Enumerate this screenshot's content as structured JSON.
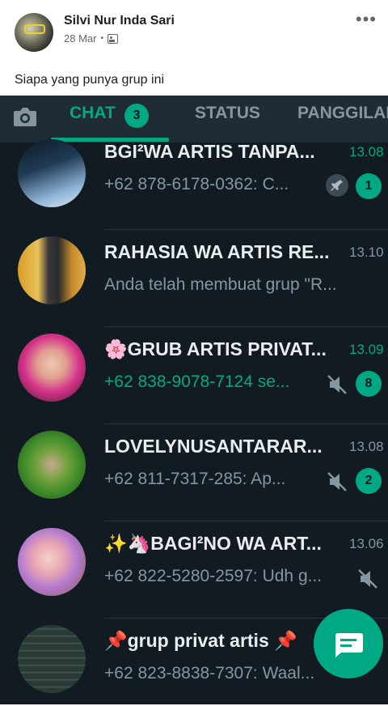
{
  "post": {
    "author": "Silvi Nur Inda Sari",
    "date": "28 Mar",
    "separator": "•",
    "caption": "Siapa yang punya grup ini"
  },
  "whatsapp": {
    "tabs": {
      "chat": "CHAT",
      "chat_badge": "3",
      "status": "STATUS",
      "calls": "PANGGILAN"
    },
    "chats": [
      {
        "name": "BGI²WA ARTIS TANPA...",
        "time": "13.08",
        "preview": "+62 878-6178-0362: C...",
        "badge": "1",
        "pinned": true,
        "muted": false,
        "unread": true
      },
      {
        "name": "RAHASIA WA ARTIS RE...",
        "time": "13.10",
        "preview": "Anda telah membuat grup \"R...",
        "badge": "",
        "pinned": false,
        "muted": false,
        "unread": false
      },
      {
        "name": "🌸GRUB ARTIS PRIVAT...",
        "time": "13.09",
        "preview": "+62 838-9078-7124 se...",
        "badge": "8",
        "pinned": false,
        "muted": true,
        "unread": true
      },
      {
        "name": "LOVELYNUSANTARAR...",
        "time": "13.08",
        "preview": "+62 811-7317-285: Ap...",
        "badge": "2",
        "pinned": false,
        "muted": true,
        "unread": true
      },
      {
        "name": "✨🦄BAGI²NO WA ART...",
        "time": "13.06",
        "preview": "+62 822-5280-2597: Udh g...",
        "badge": "",
        "pinned": false,
        "muted": true,
        "unread": false
      },
      {
        "name": "📌grup privat artis 📌",
        "time": "",
        "preview": "+62 823-8838-7307: Waal...",
        "badge": "",
        "pinned": false,
        "muted": true,
        "unread": false
      }
    ],
    "colors": {
      "accent": "#00a884",
      "background": "#111b21",
      "header": "#1f2c34"
    }
  }
}
